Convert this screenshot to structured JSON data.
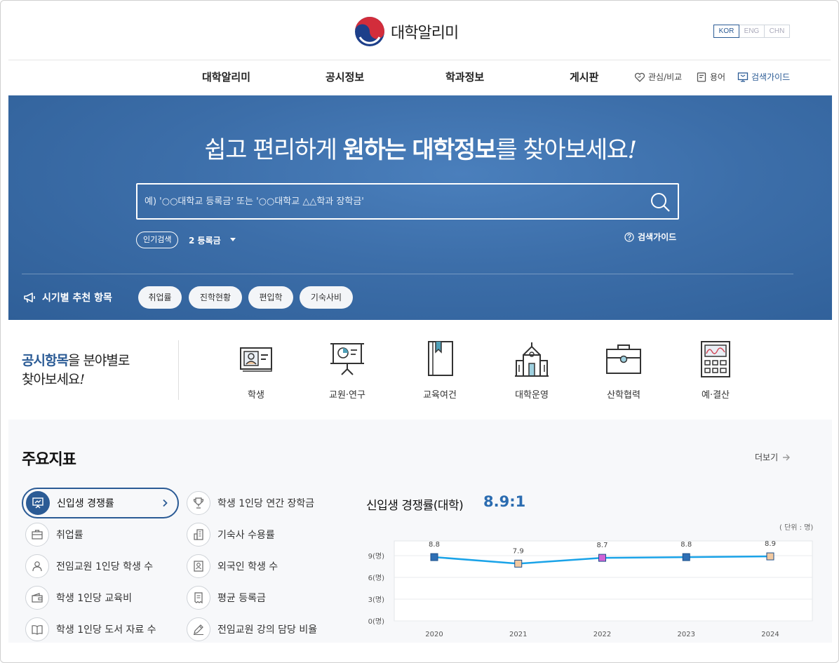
{
  "brand": {
    "name": "대학알리미",
    "colors": {
      "primary": "#2b5b95",
      "accent": "#2b6cb0",
      "line": "#1aa3e8"
    }
  },
  "lang": [
    "KOR",
    "ENG",
    "CHN"
  ],
  "nav": {
    "items": [
      "대학알리미",
      "공시정보",
      "학과정보",
      "게시판"
    ],
    "util": {
      "favorite": "관심/비교",
      "terms": "용어",
      "guide": "검색가이드"
    }
  },
  "hero": {
    "title_pre": "쉽고 편리하게 ",
    "title_b1": "원하는",
    "title_mid": " ",
    "title_b2": "대학정보",
    "title_post": "를 찾아보세요",
    "title_excl": "!",
    "search_placeholder": "예) '○○대학교 등록금' 또는 '○○대학교 △△학과 장학금'",
    "popular_label": "인기검색",
    "popular_word": "2 등록금",
    "guide": "검색가이드",
    "rec_label": "시기별 추천 항목",
    "chips": [
      "취업률",
      "진학현황",
      "편입학",
      "기숙사비"
    ]
  },
  "categories": {
    "title_b": "공시항목",
    "title_rest": "을 분야별로",
    "title_line2": "찾아보세요",
    "title_excl": "!",
    "items": [
      {
        "label": "학생",
        "icon": "student-card-icon"
      },
      {
        "label": "교원·연구",
        "icon": "presentation-board-icon"
      },
      {
        "label": "교육여건",
        "icon": "book-icon"
      },
      {
        "label": "대학운영",
        "icon": "university-building-icon"
      },
      {
        "label": "산학협력",
        "icon": "briefcase-icon"
      },
      {
        "label": "예·결산",
        "icon": "calculator-icon"
      }
    ]
  },
  "indicators": {
    "title": "주요지표",
    "more": "더보기",
    "left": [
      {
        "label": "신입생 경쟁률",
        "icon": "presentation-icon",
        "active": true
      },
      {
        "label": "취업률",
        "icon": "briefcase-icon"
      },
      {
        "label": "전임교원 1인당 학생 수",
        "icon": "person-icon"
      },
      {
        "label": "학생 1인당 교육비",
        "icon": "wallet-icon"
      },
      {
        "label": "학생 1인당 도서 자료 수",
        "icon": "open-book-icon"
      }
    ],
    "right": [
      {
        "label": "학생 1인당 연간 장학금",
        "icon": "trophy-icon"
      },
      {
        "label": "기숙사 수용률",
        "icon": "building-icon"
      },
      {
        "label": "외국인 학생 수",
        "icon": "id-card-icon"
      },
      {
        "label": "평균 등록금",
        "icon": "receipt-icon"
      },
      {
        "label": "전임교원 강의 담당 비율",
        "icon": "pencil-icon"
      }
    ]
  },
  "chart_data": {
    "type": "line",
    "title": "신입생 경쟁률(대학)",
    "headline_value": "8.9:1",
    "unit_note": "( 단위 : 명)",
    "x": [
      "2020",
      "2021",
      "2022",
      "2023",
      "2024"
    ],
    "values": [
      8.8,
      7.9,
      8.7,
      8.8,
      8.9
    ],
    "data_labels": [
      "8.8",
      "7.9",
      "8.7",
      "8.8",
      "8.9"
    ],
    "marker_colors": [
      "#2e6fb5",
      "#f2c9a0",
      "#d063d6",
      "#2e6fb5",
      "#f2c9a0"
    ],
    "yticks": [
      {
        "v": 0,
        "label": "0(명)"
      },
      {
        "v": 3,
        "label": "3(명)"
      },
      {
        "v": 6,
        "label": "6(명)"
      },
      {
        "v": 9,
        "label": "9(명)"
      }
    ],
    "ylim": [
      0,
      9.6
    ],
    "grid": true
  }
}
